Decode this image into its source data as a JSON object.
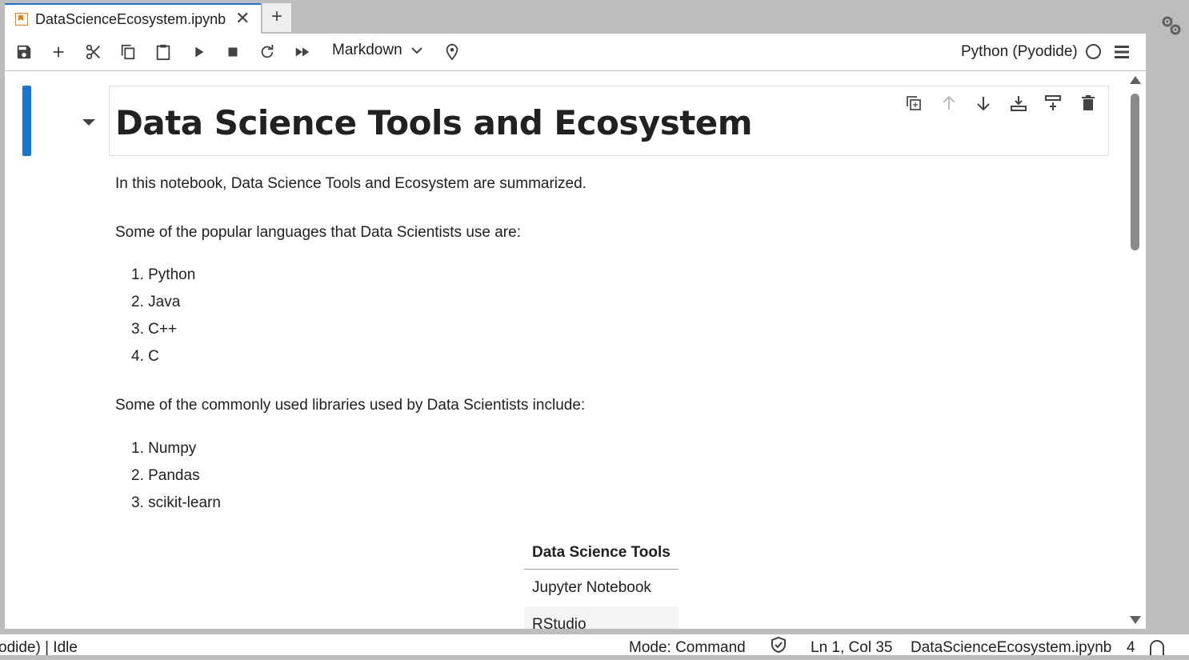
{
  "tab": {
    "title": "DataScienceEcosystem.ipynb",
    "close_glyph": "✕",
    "new_glyph": "+"
  },
  "toolbar": {
    "cell_type": "Markdown",
    "kernel_name": "Python (Pyodide)"
  },
  "notebook": {
    "heading": "Data Science Tools and Ecosystem",
    "intro": "In this notebook, Data Science Tools and Ecosystem are summarized.",
    "languages_intro": "Some of the popular languages that Data Scientists use are:",
    "languages": [
      "1. Python",
      "2. Java",
      "3. C++",
      "4. C"
    ],
    "libraries_intro": "Some of the commonly used libraries used by Data Scientists include:",
    "libraries": [
      "1. Numpy",
      "2. Pandas",
      "3. scikit-learn"
    ],
    "tools_table": {
      "header": "Data Science Tools",
      "rows": [
        "Jupyter Notebook",
        "RStudio"
      ]
    }
  },
  "statusbar": {
    "kernel_state": "odide) | Idle",
    "mode": "Mode: Command",
    "position": "Ln 1, Col 35",
    "filename": "DataScienceEcosystem.ipynb",
    "count": "4"
  },
  "colors": {
    "accent": "#1976d2",
    "notebook_icon": "#f57c00"
  }
}
